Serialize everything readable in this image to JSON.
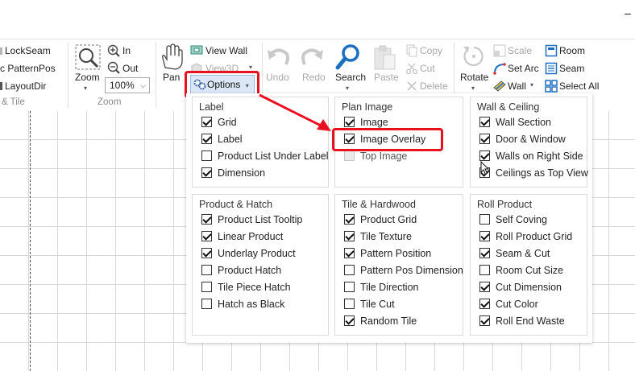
{
  "window": {
    "minimize_glyph": "–"
  },
  "ribbon": {
    "seam_group": {
      "items": [
        "LockSeam",
        "PatternPos",
        "LayoutDir"
      ],
      "label": "& Tile"
    },
    "zoom_group": {
      "zoom_label": "Zoom",
      "in_label": "In",
      "out_label": "Out",
      "zoom_value": "100%",
      "label": "Zoom"
    },
    "view_group": {
      "pan_label": "Pan",
      "view_wall_label": "View Wall",
      "view3d_label": "View3D",
      "options_label": "Options"
    },
    "edit_group": {
      "undo_label": "Undo",
      "redo_label": "Redo",
      "search_label": "Search",
      "paste_label": "Paste",
      "copy_label": "Copy",
      "cut_label": "Cut",
      "delete_label": "Delete"
    },
    "arrange_group": {
      "rotate_label": "Rotate",
      "scale_label": "Scale",
      "set_arc_label": "Set Arc",
      "wall_label": "Wall",
      "room_label": "Room",
      "seam_label": "Seam",
      "select_all_label": "Select All"
    }
  },
  "options_panel": {
    "groups": [
      {
        "title": "Label",
        "items": [
          {
            "label": "Grid",
            "checked": true
          },
          {
            "label": "Label",
            "checked": true
          },
          {
            "label": "Product List Under Label",
            "checked": false
          },
          {
            "label": "Dimension",
            "checked": true
          }
        ]
      },
      {
        "title": "Plan Image",
        "items": [
          {
            "label": "Image",
            "checked": true
          },
          {
            "label": "Image Overlay",
            "checked": true
          },
          {
            "label": "Top Image",
            "checked": false,
            "disabled": true
          }
        ]
      },
      {
        "title": "Wall & Ceiling",
        "items": [
          {
            "label": "Wall Section",
            "checked": true
          },
          {
            "label": "Door & Window",
            "checked": true
          },
          {
            "label": "Walls on Right Side",
            "checked": true
          },
          {
            "label": "Ceilings as Top View",
            "checked": true
          }
        ]
      },
      {
        "title": "Product & Hatch",
        "items": [
          {
            "label": "Product List Tooltip",
            "checked": true
          },
          {
            "label": "Linear Product",
            "checked": true
          },
          {
            "label": "Underlay Product",
            "checked": true
          },
          {
            "label": "Product Hatch",
            "checked": false
          },
          {
            "label": "Tile Piece Hatch",
            "checked": false
          },
          {
            "label": "Hatch as Black",
            "checked": false
          }
        ]
      },
      {
        "title": "Tile & Hardwood",
        "items": [
          {
            "label": "Product Grid",
            "checked": true
          },
          {
            "label": "Tile Texture",
            "checked": true
          },
          {
            "label": "Pattern Position",
            "checked": true
          },
          {
            "label": "Pattern Pos Dimension",
            "checked": false
          },
          {
            "label": "Tile Direction",
            "checked": false
          },
          {
            "label": "Tile Cut",
            "checked": false
          },
          {
            "label": "Random Tile",
            "checked": true
          }
        ]
      },
      {
        "title": "Roll Product",
        "items": [
          {
            "label": "Self Coving",
            "checked": false
          },
          {
            "label": "Roll Product Grid",
            "checked": true
          },
          {
            "label": "Seam & Cut",
            "checked": true
          },
          {
            "label": "Room Cut Size",
            "checked": false
          },
          {
            "label": "Cut Dimension",
            "checked": true
          },
          {
            "label": "Cut Color",
            "checked": true
          },
          {
            "label": "Roll End Waste",
            "checked": true
          }
        ]
      }
    ]
  },
  "colors": {
    "highlight_red": "#e8121f",
    "options_active_bg": "#dbe7f6",
    "accent_blue": "#1e6fbf"
  }
}
